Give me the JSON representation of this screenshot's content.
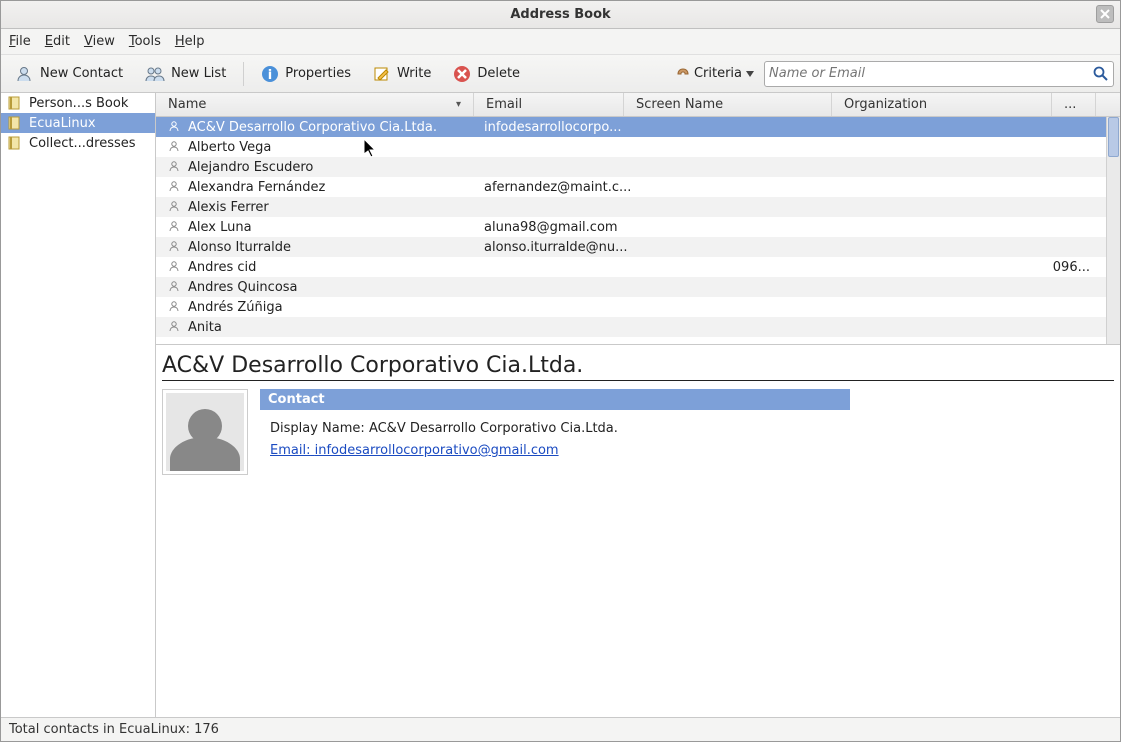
{
  "window": {
    "title": "Address Book"
  },
  "menubar": [
    "File",
    "Edit",
    "View",
    "Tools",
    "Help"
  ],
  "toolbar": {
    "new_contact": "New Contact",
    "new_list": "New List",
    "properties": "Properties",
    "write": "Write",
    "delete": "Delete",
    "criteria": "Criteria",
    "search_placeholder": "Name or Email"
  },
  "sidebar": {
    "items": [
      {
        "label": "Person...s Book"
      },
      {
        "label": "EcuaLinux"
      },
      {
        "label": "Collect...dresses"
      }
    ],
    "selected_index": 1
  },
  "table": {
    "headers": {
      "name": "Name",
      "email": "Email",
      "screen": "Screen Name",
      "org": "Organization",
      "ellipsis": "..."
    },
    "rows": [
      {
        "name": "AC&V Desarrollo Corporativo Cia.Ltda.",
        "email": "infodesarrollocorpo...",
        "screen": "",
        "org": ""
      },
      {
        "name": "Alberto Vega",
        "email": "",
        "screen": "",
        "org": ""
      },
      {
        "name": "Alejandro Escudero",
        "email": "",
        "screen": "",
        "org": ""
      },
      {
        "name": "Alexandra Fernández",
        "email": "afernandez@maint.c...",
        "screen": "",
        "org": ""
      },
      {
        "name": "Alexis Ferrer",
        "email": "",
        "screen": "",
        "org": ""
      },
      {
        "name": "Alex Luna",
        "email": "aluna98@gmail.com",
        "screen": "",
        "org": ""
      },
      {
        "name": "Alonso Iturralde",
        "email": "alonso.iturralde@nu...",
        "screen": "",
        "org": ""
      },
      {
        "name": "Andres cid",
        "email": "",
        "screen": "",
        "org": "096..."
      },
      {
        "name": "Andres Quincosa",
        "email": "",
        "screen": "",
        "org": ""
      },
      {
        "name": "Andrés Zúñiga",
        "email": "",
        "screen": "",
        "org": ""
      },
      {
        "name": "Anita",
        "email": "",
        "screen": "",
        "org": ""
      }
    ],
    "selected_index": 0
  },
  "detail": {
    "title": "AC&V Desarrollo Corporativo Cia.Ltda.",
    "section": "Contact",
    "display_name_label": "Display Name:",
    "display_name": "AC&V Desarrollo Corporativo Cia.Ltda.",
    "email_label": "Email:",
    "email": "infodesarrollocorporativo@gmail.com"
  },
  "statusbar": {
    "text": "Total contacts in EcuaLinux: 176"
  }
}
